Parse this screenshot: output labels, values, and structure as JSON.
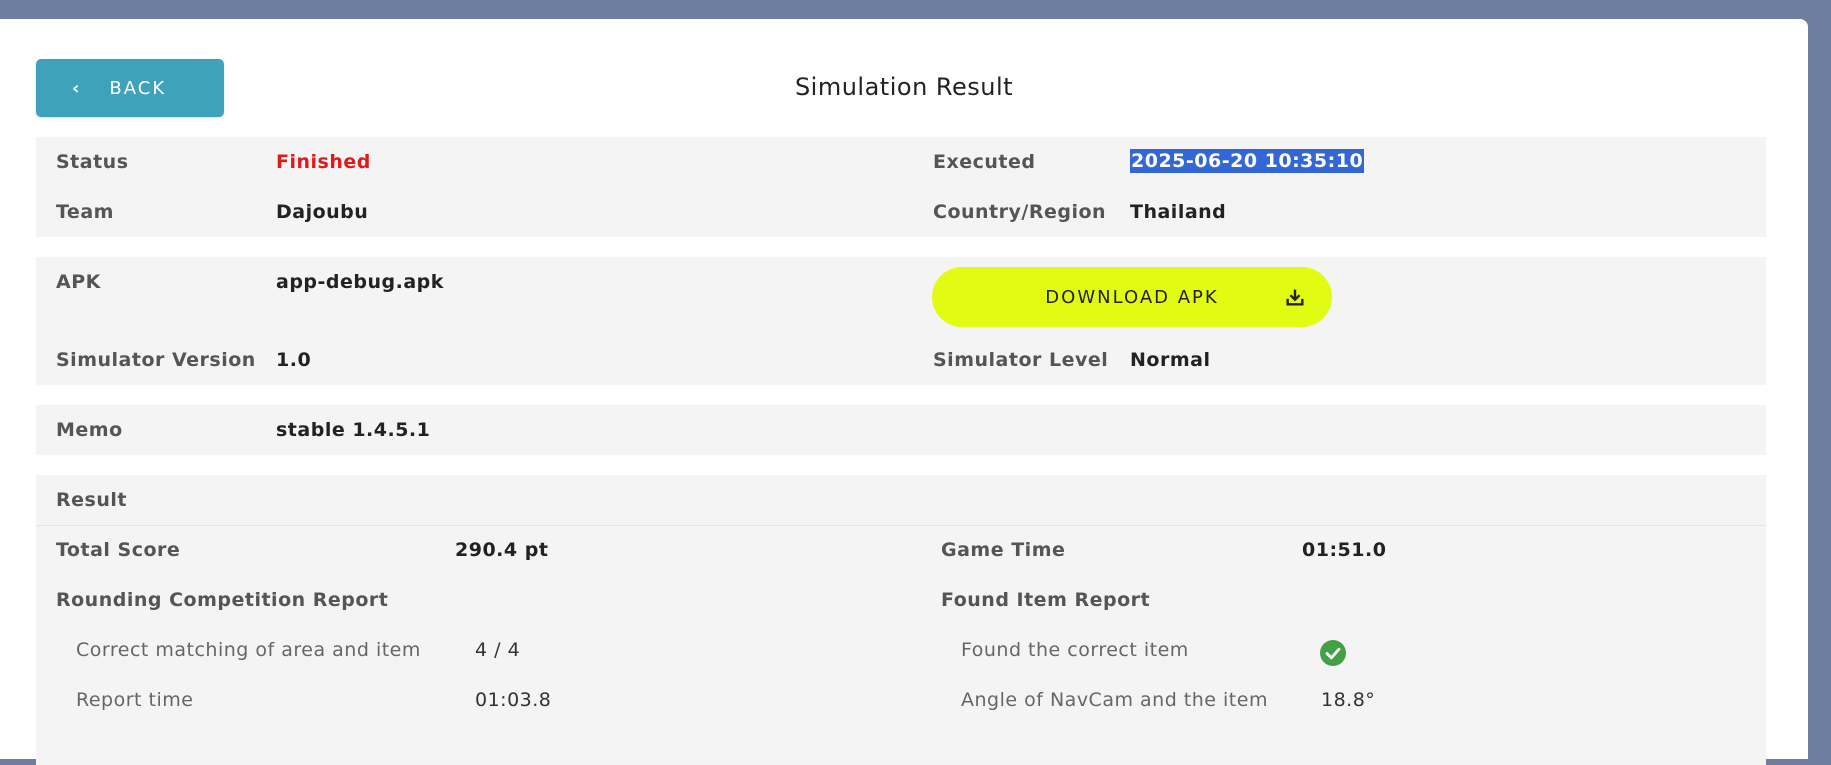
{
  "header": {
    "back_label": "BACK",
    "back_icon": "chevron-left-icon",
    "title": "Simulation Result"
  },
  "info": {
    "status_label": "Status",
    "status_value": "Finished",
    "status_color": "#e01a1a",
    "executed_label": "Executed",
    "executed_value": "2025-06-20 10:35:10",
    "team_label": "Team",
    "team_value": "Dajoubu",
    "country_label": "Country/Region",
    "country_value": "Thailand"
  },
  "apk": {
    "apk_label": "APK",
    "apk_value": "app-debug.apk",
    "download_label": "DOWNLOAD APK",
    "download_icon": "download-icon",
    "download_color": "#e2fb13",
    "sim_version_label": "Simulator Version",
    "sim_version_value": "1.0",
    "sim_level_label": "Simulator Level",
    "sim_level_value": "Normal"
  },
  "memo": {
    "label": "Memo",
    "value": "stable 1.4.5.1"
  },
  "result": {
    "heading": "Result",
    "total_score_label": "Total Score",
    "total_score_value": "290.4 pt",
    "game_time_label": "Game Time",
    "game_time_value": "01:51.0",
    "rounding_heading": "Rounding Competition Report",
    "found_heading": "Found Item Report",
    "matching_label": "Correct matching of area and item",
    "matching_value": "4 / 4",
    "report_time_label": "Report time",
    "report_time_value": "01:03.8",
    "found_correct_label": "Found the correct item",
    "found_correct_icon": "check-circle-icon",
    "found_correct_color": "#43a047",
    "angle_label": "Angle of NavCam and the item",
    "angle_value": "18.8°"
  }
}
